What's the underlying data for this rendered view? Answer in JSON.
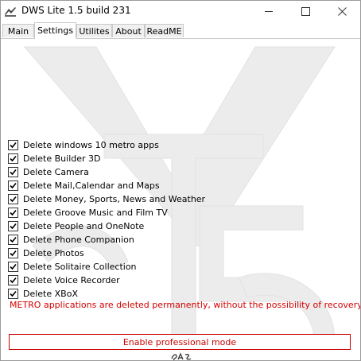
{
  "window": {
    "title": "DWS Lite 1.5 build 231"
  },
  "tabs": [
    {
      "label": "Main"
    },
    {
      "label": "Settings"
    },
    {
      "label": "Utilites"
    },
    {
      "label": "About"
    },
    {
      "label": "ReadME"
    }
  ],
  "active_tab": "Settings",
  "settings": {
    "options": [
      {
        "label": "Delete windows 10 metro apps",
        "checked": true
      },
      {
        "label": "Delete Builder 3D",
        "checked": true
      },
      {
        "label": "Delete Camera",
        "checked": true
      },
      {
        "label": "Delete Mail,Calendar and Maps",
        "checked": true
      },
      {
        "label": "Delete Money, Sports, News and Weather",
        "checked": true
      },
      {
        "label": "Delete Groove Music and Film TV",
        "checked": true
      },
      {
        "label": "Delete People and OneNote",
        "checked": true
      },
      {
        "label": "Delete Phone Companion",
        "checked": true
      },
      {
        "label": "Delete Photos",
        "checked": true
      },
      {
        "label": "Delete Solitaire Collection",
        "checked": true
      },
      {
        "label": "Delete Voice Recorder",
        "checked": true
      },
      {
        "label": "Delete XBoX",
        "checked": true
      }
    ],
    "warning": "METRO applications are deleted permanently, without the possibility of recovery.",
    "pro_button_label": "Enable professional mode"
  },
  "colors": {
    "warning": "#d40000",
    "pro_button_border": "#cc0000",
    "watermark": "#ececec"
  },
  "icons": {
    "app": "app-logo-icon",
    "minimize": "minimize-icon",
    "maximize": "maximize-icon",
    "close": "close-icon",
    "checkmark": "checkmark-icon"
  }
}
